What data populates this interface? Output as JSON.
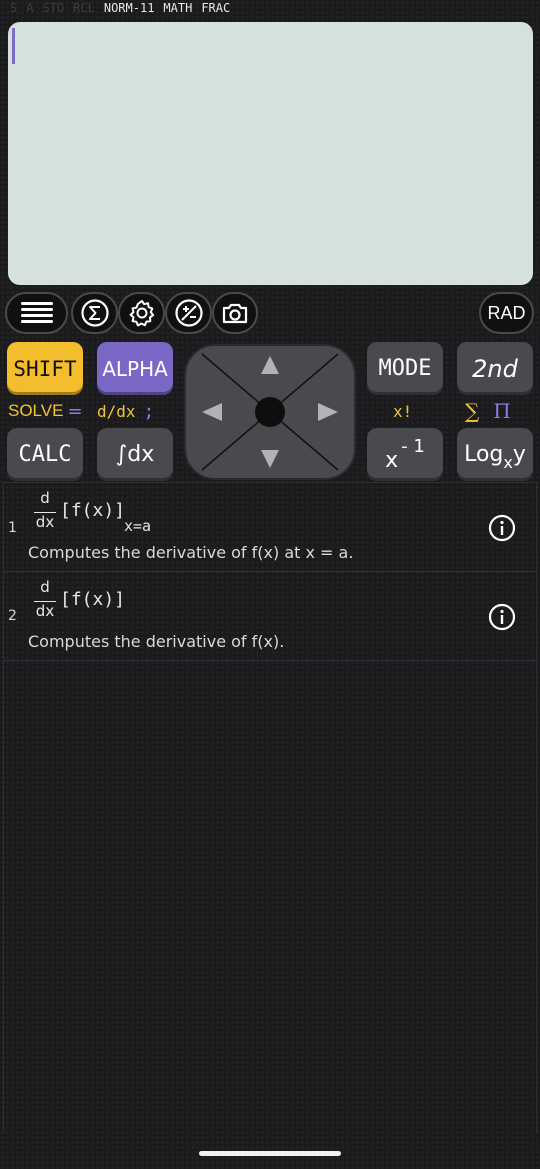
{
  "status_bar": {
    "dim_items": [
      "S",
      "A",
      "STO",
      "RCL"
    ],
    "lit_items": [
      "NORM-11",
      "MATH",
      "FRAC"
    ]
  },
  "toolbar": {
    "icons": [
      "menu-icon",
      "sigma-icon",
      "settings-icon",
      "plus-minus-icon",
      "camera-icon"
    ],
    "angle_mode": "RAD"
  },
  "keys": {
    "shift": "SHIFT",
    "alpha": "ALPHA",
    "mode": "MODE",
    "second": "2nd",
    "calc": "CALC",
    "integral": "∫dx",
    "inverse_base": "x",
    "inverse_exp": "- 1",
    "log_main": "Log",
    "log_sub": "x",
    "log_end": "y",
    "secondary": {
      "solve": "SOLVE",
      "equals": "=",
      "ddx": "d/dx",
      "semicolon": ";",
      "factorial": "x!",
      "sigma": "∑",
      "pi_product": "Π"
    }
  },
  "dpad": {
    "icons": [
      "arrow-up-icon",
      "arrow-left-icon",
      "arrow-right-icon",
      "arrow-down-icon"
    ]
  },
  "results": [
    {
      "index": "1",
      "numerator": "d",
      "denominator": "dx",
      "body": "[f(x)]",
      "subscript": "x=a",
      "description": "Computes the derivative of f(x) at x = a."
    },
    {
      "index": "2",
      "numerator": "d",
      "denominator": "dx",
      "body": "[f(x)]",
      "subscript": "",
      "description": "Computes the derivative of f(x)."
    }
  ],
  "colors": {
    "shift": "#f3bd2e",
    "alpha": "#7a67c6",
    "screen": "#d4e1df",
    "key": "#4a4a4e"
  }
}
